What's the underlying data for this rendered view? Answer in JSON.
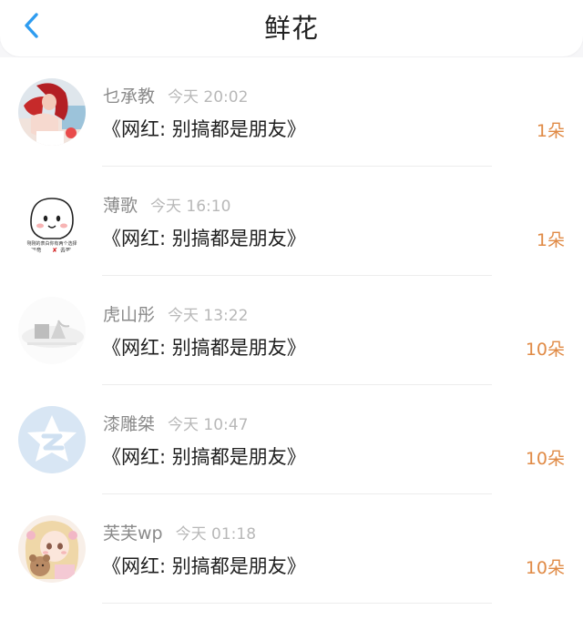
{
  "header": {
    "title": "鲜花",
    "back_icon": "chevron-left-icon",
    "accent_color": "#2e9cf0"
  },
  "avatar_images": [
    "girl-red-hair-photo",
    "cartoon-white-face-sticker",
    "faded-landscape-photo",
    "qzone-star-logo",
    "anime-girl-with-bear"
  ],
  "avatar_texts": {
    "sticker_line1": "刚刚的表白你有两个选择",
    "sticker_agree": "°同意",
    "sticker_x": "✘",
    "sticker_refuse": "去死"
  },
  "items": [
    {
      "name": "乜承教",
      "time": "今天 20:02",
      "content": "《网红: 别搞都是朋友》",
      "count": "1朵"
    },
    {
      "name": "薄歌",
      "time": "今天 16:10",
      "content": "《网红: 别搞都是朋友》",
      "count": "1朵"
    },
    {
      "name": "虎山彤",
      "time": "今天 13:22",
      "content": "《网红: 别搞都是朋友》",
      "count": "10朵"
    },
    {
      "name": "漆雕桀",
      "time": "今天 10:47",
      "content": "《网红: 别搞都是朋友》",
      "count": "10朵"
    },
    {
      "name": "芙芙wp",
      "time": "今天 01:18",
      "content": "《网红: 别搞都是朋友》",
      "count": "10朵"
    }
  ]
}
